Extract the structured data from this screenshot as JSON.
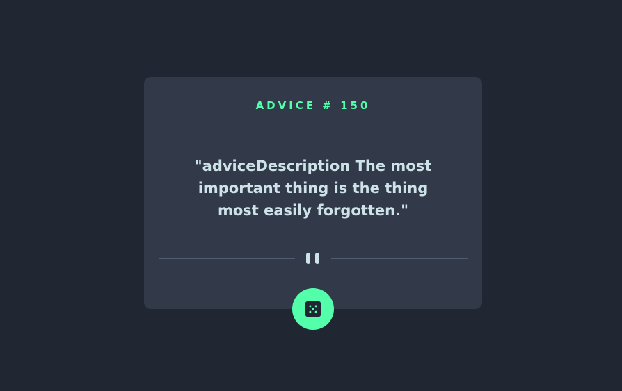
{
  "card": {
    "advice_label": "ADVICE #",
    "advice_number": "150",
    "advice_text": "\"adviceDescription The most important thing is the thing most easily forgotten.\""
  },
  "divider": {
    "icon": "pause-icon"
  },
  "button": {
    "icon": "dice-icon"
  },
  "colors": {
    "background": "#202632",
    "card": "#323a49",
    "accent": "#53ffaa",
    "text": "#cee3e9",
    "divider": "#4f5d74"
  }
}
